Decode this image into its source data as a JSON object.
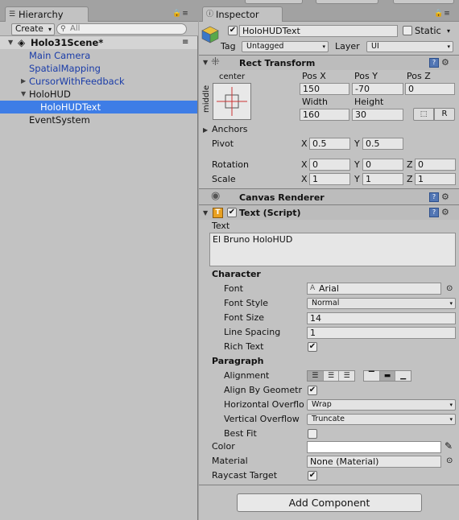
{
  "hierarchy": {
    "tab_title": "Hierarchy",
    "create_label": "Create",
    "search_placeholder": "All",
    "scene_name": "Holo31Scene*",
    "items": [
      {
        "label": "Main Camera",
        "blue": true
      },
      {
        "label": "SpatialMapping",
        "blue": true
      },
      {
        "label": "CursorWithFeedback",
        "blue": true,
        "collapsed": true
      },
      {
        "label": "HoloHUD",
        "blue": false,
        "expanded": true
      },
      {
        "label": "HoloHUDText",
        "blue": false,
        "selected": true
      },
      {
        "label": "EventSystem",
        "blue": false
      }
    ]
  },
  "inspector": {
    "tab_title": "Inspector",
    "object_name": "HoloHUDText",
    "active": true,
    "static_label": "Static",
    "tag_label": "Tag",
    "tag_value": "Untagged",
    "layer_label": "Layer",
    "layer_value": "UI",
    "rect_transform": {
      "title": "Rect Transform",
      "anchor_h": "center",
      "anchor_v": "middle",
      "pos_x_label": "Pos X",
      "pos_y_label": "Pos Y",
      "pos_z_label": "Pos Z",
      "pos_x": "150",
      "pos_y": "-70",
      "pos_z": "0",
      "width_label": "Width",
      "height_label": "Height",
      "width": "160",
      "height": "30",
      "raw_button": "R",
      "anchors_label": "Anchors",
      "pivot_label": "Pivot",
      "pivot_x": "0.5",
      "pivot_y": "0.5",
      "rotation_label": "Rotation",
      "rot_x": "0",
      "rot_y": "0",
      "rot_z": "0",
      "scale_label": "Scale",
      "scale_x": "1",
      "scale_y": "1",
      "scale_z": "1",
      "axis_x": "X",
      "axis_y": "Y",
      "axis_z": "Z"
    },
    "canvas_renderer": {
      "title": "Canvas Renderer"
    },
    "text_script": {
      "title": "Text (Script)",
      "enabled": true,
      "text_label": "Text",
      "text_value": "El Bruno HoloHUD",
      "character_header": "Character",
      "font_label": "Font",
      "font_value": "Arial",
      "font_style_label": "Font Style",
      "font_style_value": "Normal",
      "font_size_label": "Font Size",
      "font_size_value": "14",
      "line_spacing_label": "Line Spacing",
      "line_spacing_value": "1",
      "rich_text_label": "Rich Text",
      "rich_text": true,
      "paragraph_header": "Paragraph",
      "alignment_label": "Alignment",
      "align_by_geometry_label": "Align By Geometr",
      "align_by_geometry": true,
      "horizontal_overflow_label": "Horizontal Overflo",
      "horizontal_overflow_value": "Wrap",
      "vertical_overflow_label": "Vertical Overflow",
      "vertical_overflow_value": "Truncate",
      "best_fit_label": "Best Fit",
      "best_fit": false,
      "color_label": "Color",
      "color_value": "#ffffff",
      "material_label": "Material",
      "material_value": "None (Material)",
      "raycast_label": "Raycast Target",
      "raycast": true
    },
    "add_component_label": "Add Component"
  }
}
